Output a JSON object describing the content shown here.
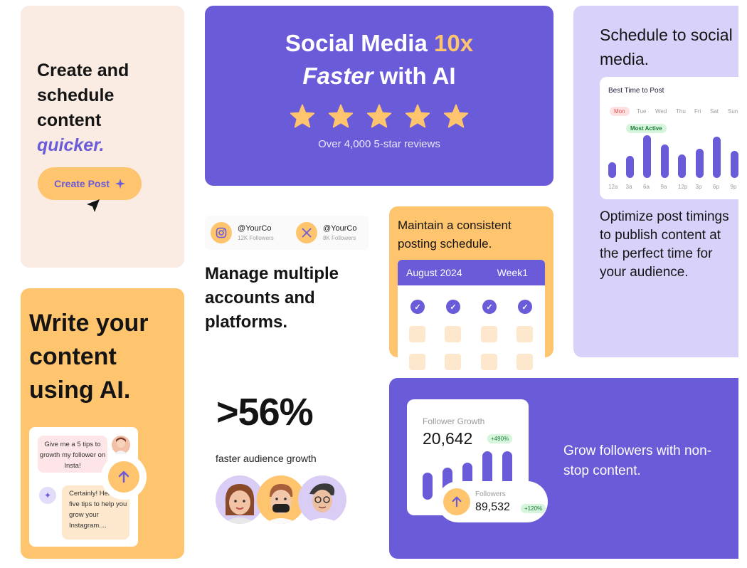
{
  "create_card": {
    "title_lines": [
      "Create and",
      "schedule",
      "content"
    ],
    "title_accent": "quicker.",
    "button_label": "Create Post"
  },
  "hero": {
    "line1_a": "Social Media ",
    "line1_b": "10x",
    "line2_a": "Faster",
    "line2_b": " with AI",
    "rating_stars": 5,
    "reviews": "Over 4,000 5-star reviews"
  },
  "schedule_card": {
    "title": "Schedule to social media.",
    "chart_title": "Best Time to Post",
    "days": [
      "Mon",
      "Tue",
      "Wed",
      "Thu",
      "Fri",
      "Sat",
      "Sun"
    ],
    "most_active": "Most Active",
    "times": [
      "12a",
      "3a",
      "6a",
      "9a",
      "12p",
      "3p",
      "6p",
      "9p"
    ],
    "activity": [
      22,
      31,
      60,
      47,
      33,
      41,
      58,
      38
    ],
    "body": "Optimize post timings to publish content at the perfect time for your audience."
  },
  "accounts": {
    "items": [
      {
        "handle": "@YourCo",
        "followers": "12K Followers",
        "icon": "instagram-icon"
      },
      {
        "handle": "@YourCo",
        "followers": "8K Followers",
        "icon": "x-icon"
      }
    ],
    "title": "Manage multiple accounts and platforms."
  },
  "calendar_card": {
    "title": "Maintain a consistent posting schedule.",
    "month": "August 2024",
    "week": "Week1"
  },
  "ai_card": {
    "title": "Write your content using AI.",
    "user_msg": "Give me a 5 tips to growth my follower on Insta!",
    "ai_msg": "Certainly! Here are five tips to help you grow your Instagram...."
  },
  "stat": {
    "value": ">56%",
    "label": "faster audience growth"
  },
  "followers_card": {
    "growth_label": "Follower Growth",
    "growth_value": "20,642",
    "growth_badge": "+490%",
    "followers_label": "Followers",
    "followers_value": "89,532",
    "followers_badge": "+120%",
    "growth_bars": [
      38,
      45,
      52,
      68,
      68
    ],
    "body": "Grow followers with non-stop content."
  },
  "colors": {
    "purple": "#6a5bd8",
    "orange": "#ffc46e",
    "peach": "#fbece3",
    "lavender": "#d8d2fb"
  }
}
